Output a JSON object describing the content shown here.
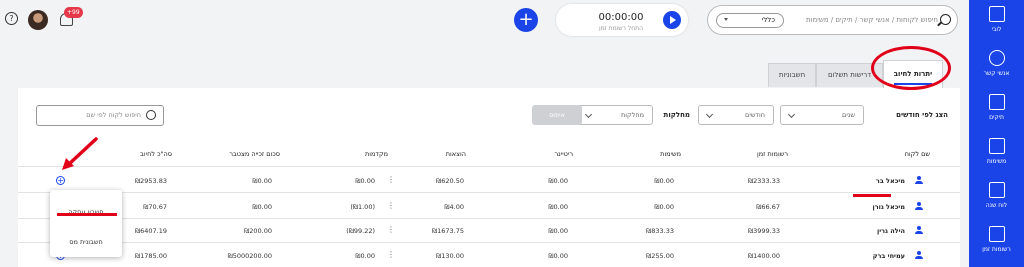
{
  "topbar": {
    "help_glyph": "?",
    "notification_badge": "+99",
    "plus_glyph": "+",
    "timer_time": "00:00:00",
    "timer_subtitle": "התחל רשומת זמן",
    "search_placeholder": "חיפוש לקוחות / אנשי קשר / תיקים / משימות",
    "search_scope": "כללי"
  },
  "sidebar": {
    "items": [
      {
        "label": "לובי",
        "icon": "dashboard-icon"
      },
      {
        "label": "אנשי קשר",
        "icon": "contacts-icon"
      },
      {
        "label": "תיקים",
        "icon": "folder-icon"
      },
      {
        "label": "משימות",
        "icon": "tasks-icon"
      },
      {
        "label": "לוח שנה",
        "icon": "calendar-icon"
      },
      {
        "label": "רשומות זמן",
        "icon": "time-entries-icon"
      }
    ]
  },
  "tabs": [
    {
      "label": "יתרות לחיוב",
      "active": true
    },
    {
      "label": "דרישות תשלום",
      "active": false
    },
    {
      "label": "חשבוניות",
      "active": false
    }
  ],
  "filters": {
    "label": "הצג לפי חודשים",
    "years": "שנים",
    "months": "חודשים",
    "departments_label": "מחלקות",
    "departments": "מחלקות",
    "reset": "איפוס",
    "customer_search_placeholder": "חיפוש לקוח לפי שם"
  },
  "table": {
    "columns": [
      "שם לקוח",
      "רשומות זמן",
      "משימות",
      "ריטיינר",
      "הוצאות",
      "מקדמות",
      "סכום זכייה מצטבר",
      "סה\"כ לחיוב"
    ],
    "rows": [
      {
        "name": "מיכאל בר",
        "time": "₪2333.33",
        "tasks": "₪0.00",
        "retainer": "₪0.00",
        "expenses": "₪620.50",
        "advances": "₪0.00",
        "win": "₪0.00",
        "total": "₪2953.83"
      },
      {
        "name": "מיכאל גורן",
        "time": "₪66.67",
        "tasks": "₪0.00",
        "retainer": "₪0.00",
        "expenses": "₪4.00",
        "advances": "(₪1.00)",
        "win": "₪0.00",
        "total": "₪70.67"
      },
      {
        "name": "הילה גרין",
        "time": "₪3999.33",
        "tasks": "₪833.33",
        "retainer": "₪0.00",
        "expenses": "₪1673.75",
        "advances": "(₪99.22)",
        "win": "₪200.00",
        "total": "₪6407.19"
      },
      {
        "name": "עמיחי ברק",
        "time": "₪1400.00",
        "tasks": "₪255.00",
        "retainer": "₪0.00",
        "expenses": "₪130.00",
        "advances": "₪0.00",
        "win": "₪5000200.00",
        "total": "₪1785.00"
      }
    ]
  },
  "popup": {
    "options": [
      "חשבון עסקה",
      "חשבונית מס"
    ]
  },
  "colors": {
    "brand": "#1a44e8",
    "annotation": "#e1001a",
    "badge": "#e53949"
  }
}
